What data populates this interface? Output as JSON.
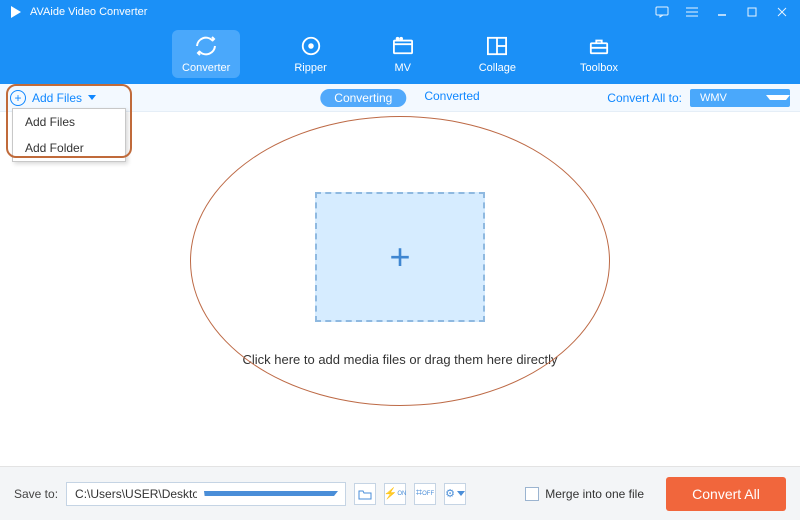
{
  "title": "AVAide Video Converter",
  "nav": {
    "converter": "Converter",
    "ripper": "Ripper",
    "mv": "MV",
    "collage": "Collage",
    "toolbox": "Toolbox"
  },
  "addFiles": {
    "button": "Add Files",
    "menu": {
      "files": "Add Files",
      "folder": "Add Folder"
    }
  },
  "tabs": {
    "converting": "Converting",
    "converted": "Converted"
  },
  "convertAll": {
    "label": "Convert All to:",
    "value": "WMV"
  },
  "stage": {
    "hint": "Click here to add media files or drag them here directly"
  },
  "bottom": {
    "saveLabel": "Save to:",
    "path": "C:\\Users\\USER\\Desktop\\draft",
    "merge": "Merge into one file",
    "convert": "Convert All"
  },
  "miniIcons": {
    "on": "ON",
    "off": "OFF"
  }
}
